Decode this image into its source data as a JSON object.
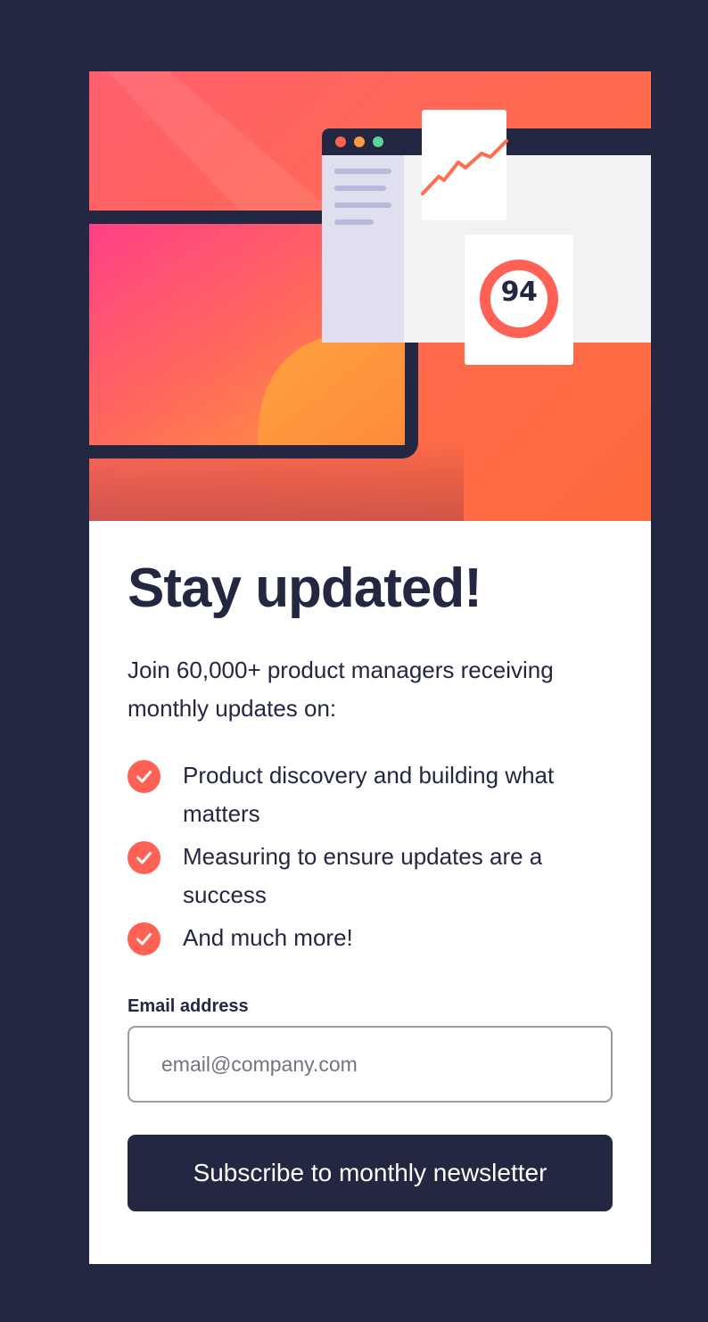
{
  "hero": {
    "score": "94"
  },
  "title": "Stay updated!",
  "intro": "Join 60,000+ product managers receiving monthly updates on:",
  "features": [
    "Product discovery and building what matters",
    "Measuring to ensure updates are a success",
    "And much more!"
  ],
  "form": {
    "email_label": "Email address",
    "email_placeholder": "email@company.com",
    "submit_label": "Subscribe to monthly newsletter"
  },
  "colors": {
    "background": "#242742",
    "accent": "#ff6155",
    "text": "#242742"
  }
}
